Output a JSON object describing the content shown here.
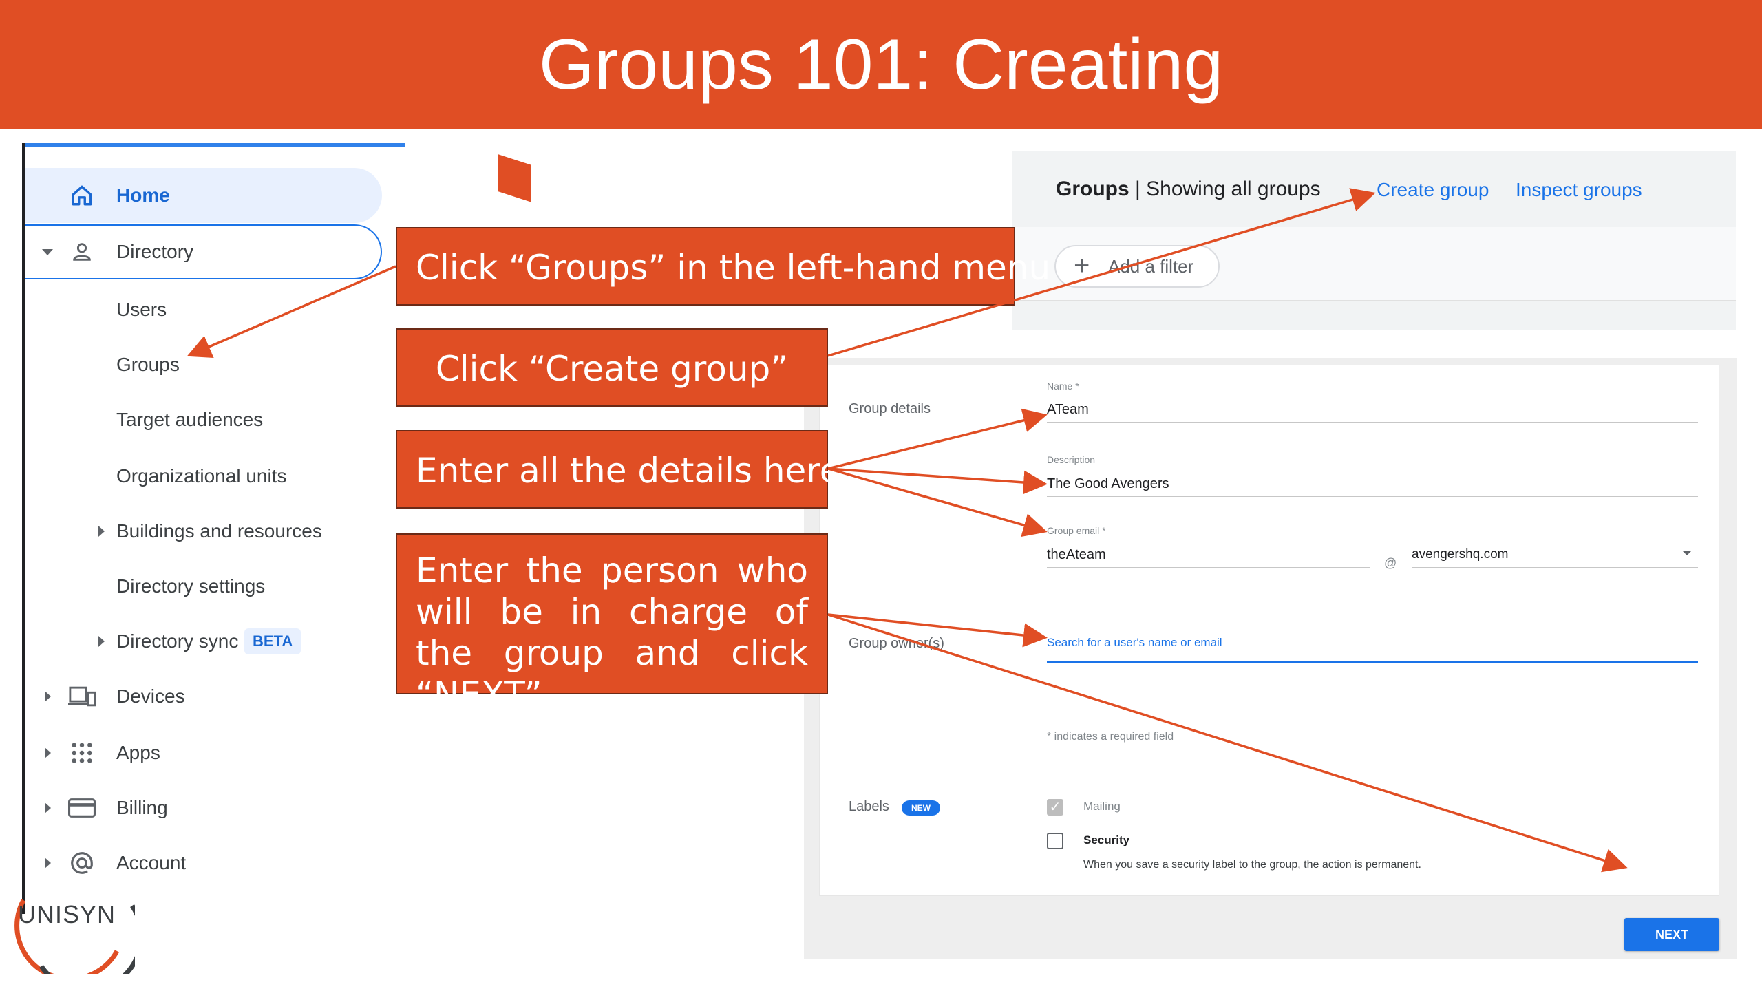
{
  "slide": {
    "title": "Groups 101: Creating"
  },
  "sidebar": {
    "items": [
      {
        "label": "Home"
      },
      {
        "label": "Directory"
      },
      {
        "label": "Users"
      },
      {
        "label": "Groups"
      },
      {
        "label": "Target audiences"
      },
      {
        "label": "Organizational units"
      },
      {
        "label": "Buildings and resources"
      },
      {
        "label": "Directory settings"
      },
      {
        "label": "Directory sync",
        "badge": "BETA"
      },
      {
        "label": "Devices"
      },
      {
        "label": "Apps"
      },
      {
        "label": "Billing"
      },
      {
        "label": "Account"
      }
    ]
  },
  "logo": {
    "text": "UNISYN"
  },
  "callouts": {
    "step1": "Click “Groups” in the left-hand menu",
    "step2": "Click “Create group”",
    "step3": "Enter all the details here",
    "step4": "Enter the person who will be in charge of the group and click “NEXT”"
  },
  "groups_header": {
    "title_bold": "Groups",
    "title_rest": " | Showing all groups",
    "create_link": "Create group",
    "inspect_link": "Inspect groups",
    "filter_label": "Add a filter",
    "filter_icon": "plus-icon"
  },
  "form": {
    "section_details": "Group details",
    "name_label": "Name *",
    "name_value": "ATeam",
    "description_label": "Description",
    "description_value": "The Good Avengers",
    "email_label": "Group email *",
    "email_value": "theAteam",
    "at_sign": "@",
    "domain_value": "avengershq.com",
    "section_owners": "Group owner(s)",
    "owners_placeholder": "Search for a user's name or email",
    "required_note": "* indicates a required field",
    "section_labels": "Labels",
    "new_badge": "NEW",
    "label_mailing": "Mailing",
    "label_mailing_checked": true,
    "label_security": "Security",
    "label_security_checked": false,
    "security_note": "When you save a security label to the group, the action is permanent.",
    "next_button": "NEXT"
  },
  "colors": {
    "banner": "#e04e24",
    "accent_blue": "#1a73e8",
    "arrow": "#e04e24"
  }
}
